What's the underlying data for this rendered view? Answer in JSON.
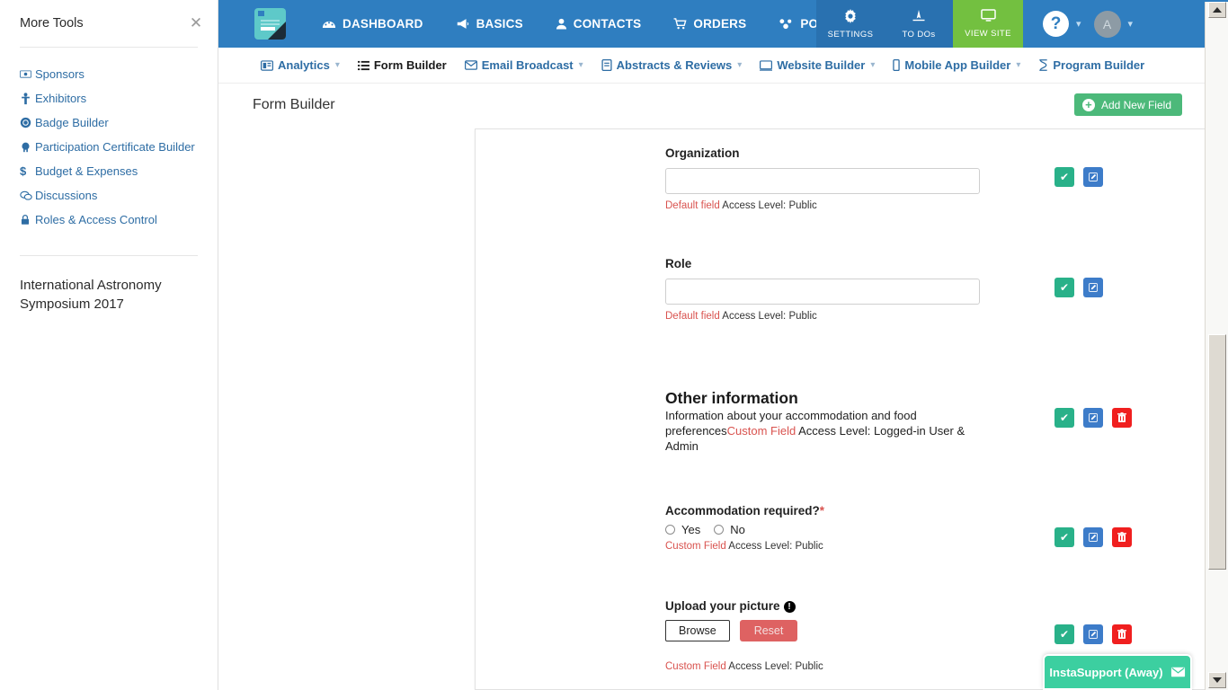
{
  "sidebar": {
    "title": "More Tools",
    "close_icon": "close-icon",
    "items": [
      {
        "label": "Sponsors",
        "icon": "money-bill-icon"
      },
      {
        "label": "Exhibitors",
        "icon": "person-booth-icon"
      },
      {
        "label": "Badge Builder",
        "icon": "badge-icon"
      },
      {
        "label": "Participation Certificate Builder",
        "icon": "certificate-icon"
      },
      {
        "label": "Budget & Expenses",
        "icon": "dollar-sign-icon"
      },
      {
        "label": "Discussions",
        "icon": "comments-icon"
      },
      {
        "label": "Roles & Access Control",
        "icon": "lock-icon"
      }
    ],
    "event_name": "International Astronomy Symposium 2017"
  },
  "topbar": {
    "logo": "app-logo-icon",
    "nav": [
      {
        "label": "DASHBOARD",
        "icon": "dashboard-icon"
      },
      {
        "label": "BASICS",
        "icon": "megaphone-icon"
      },
      {
        "label": "CONTACTS",
        "icon": "contacts-icon"
      },
      {
        "label": "ORDERS",
        "icon": "cart-icon"
      },
      {
        "label": "POWER-UPs",
        "icon": "powerups-icon"
      }
    ],
    "utilities": [
      {
        "label": "SETTINGS",
        "icon": "gear-icon"
      },
      {
        "label": "TO DOs",
        "icon": "todos-icon"
      }
    ],
    "view_site": {
      "label": "VIEW SITE",
      "icon": "monitor-icon"
    },
    "help": "?",
    "avatar": "A",
    "accent_blue": "#2f7ec0",
    "accent_green": "#73c040"
  },
  "subnav": {
    "items": [
      {
        "label": "Analytics",
        "icon": "analytics-icon",
        "caret": true,
        "active": false
      },
      {
        "label": "Form Builder",
        "icon": "list-icon",
        "caret": false,
        "active": true
      },
      {
        "label": "Email Broadcast",
        "icon": "envelope-icon",
        "caret": true,
        "active": false
      },
      {
        "label": "Abstracts & Reviews",
        "icon": "document-icon",
        "caret": true,
        "active": false
      },
      {
        "label": "Website Builder",
        "icon": "window-icon",
        "caret": true,
        "active": false
      },
      {
        "label": "Mobile App Builder",
        "icon": "mobile-icon",
        "caret": true,
        "active": false
      },
      {
        "label": "Program Builder",
        "icon": "hourglass-icon",
        "caret": false,
        "active": false
      }
    ]
  },
  "page": {
    "title": "Form Builder",
    "add_button": {
      "label": "Add New Field",
      "icon": "plus-circle-icon"
    }
  },
  "form": {
    "fields": [
      {
        "type": "text",
        "label": "Organization",
        "value": "",
        "placeholder": "",
        "tag": "Default field",
        "meta": " Access Level: Public",
        "actions": [
          "ok",
          "edit"
        ]
      },
      {
        "type": "text",
        "label": "Role",
        "value": "",
        "placeholder": "",
        "tag": "Default field",
        "meta": " Access Level: Public",
        "actions": [
          "ok",
          "edit"
        ]
      },
      {
        "type": "section",
        "label": "Other information",
        "description": "Information about your accommodation and food preferences",
        "tag": "Custom Field",
        "meta": " Access Level: Logged-in User & Admin",
        "actions": [
          "ok",
          "edit",
          "delete"
        ]
      },
      {
        "type": "radio",
        "label": "Accommodation required?",
        "required": true,
        "options": [
          "Yes",
          "No"
        ],
        "tag": "Custom Field",
        "meta": " Access Level: Public",
        "actions": [
          "ok",
          "edit",
          "delete"
        ]
      },
      {
        "type": "file",
        "label": "Upload your picture",
        "info_icon": "info-circle-icon",
        "browse_label": "Browse",
        "reset_label": "Reset",
        "tag": "Custom Field",
        "meta": " Access Level: Public",
        "actions": [
          "ok",
          "edit",
          "delete"
        ]
      }
    ],
    "action_icons": {
      "ok": "check-icon",
      "edit": "pencil-square-icon",
      "delete": "trash-icon"
    },
    "action_colors": {
      "ok": "#29b189",
      "edit": "#3d7cc9",
      "delete": "#f01f1f"
    }
  },
  "chat": {
    "label": "InstaSupport (Away)",
    "icon": "envelope-icon",
    "color": "#3ccfa0"
  }
}
